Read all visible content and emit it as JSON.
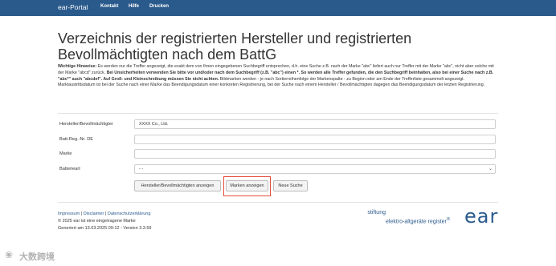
{
  "navbar": {
    "brand": "ear-Portal",
    "links": [
      "Kontakt",
      "Hilfe",
      "Drucken"
    ]
  },
  "page_title": "Verzeichnis der registrierten Hersteller und registrierten Bevollmächtigten nach dem BattG",
  "hints": {
    "lead": "Wichtige Hinweise:",
    "part1": " Es werden nur die Treffer angezeigt, die exakt dem von Ihnen eingegebenen Suchbegriff entsprechen, d.h. eine Suche z.B. nach der Marke \"abc\" liefert auch nur Treffer mit der Marke \"abc\", nicht aber solche mit der Marke \"abcd\" zurück. ",
    "bold1": "Bei Unsicherheiten verwenden Sie bitte vor und/oder nach dem Suchbegriff (z.B. \"abc\") einen *. So werden alle Treffer gefunden, die den Suchbegriff beinhalten, also bei einer Suche nach z.B. \"abc*\" auch \"abcdef\". Auf Groß- und Kleinschreibung müssen Sie nicht achten.",
    "part2": " Bildmarken werden - je nach Sortierreihenfolge der Markenspalte - zu Beginn oder am Ende der Trefferliste gesammelt angezeigt. Marktaustrittsdatum ist bei der Suche nach einer Marke das Beendigungsdatum einer konkreten Registrierung, bei der Suche nach einem Hersteller / Bevollmächtigten dagegen das Beendigungsdatum der letzten Registrierung."
  },
  "form": {
    "manufacturer_label": "Hersteller/Bevollmächtigter",
    "manufacturer_value": "XXXX Co., Ltd.",
    "reg_label": "Batt-Reg.-Nr. DE",
    "reg_value": "",
    "brand_label": "Marke",
    "brand_value": "",
    "battery_label": "Batterieart",
    "battery_selected": "- -"
  },
  "buttons": {
    "show_manufacturers": "Hersteller/Bevollmächtigten anzeigen",
    "show_brands": "Marken anzeigen",
    "new_search": "Neue Suche"
  },
  "footer": {
    "impressum": "Impressum",
    "disclaimer": "Disclaimer",
    "privacy": "Datenschutzerklärung",
    "separator": " | ",
    "trademark": "© 2025 ear ist eine eingetragene Marke",
    "generated": "Generiert am 13.03.2025 09:12 - Version 3.3.59"
  },
  "logo": {
    "line1": "stiftung",
    "line2": "elektro-altgeräte register",
    "mark": "ear",
    "reg": "®"
  },
  "watermark": {
    "glyph": "❀",
    "text": "大数跨境"
  },
  "colors": {
    "navbar": "#2a5a8c",
    "highlight": "#e24b3a",
    "brand_blue": "#2a5a8c"
  }
}
